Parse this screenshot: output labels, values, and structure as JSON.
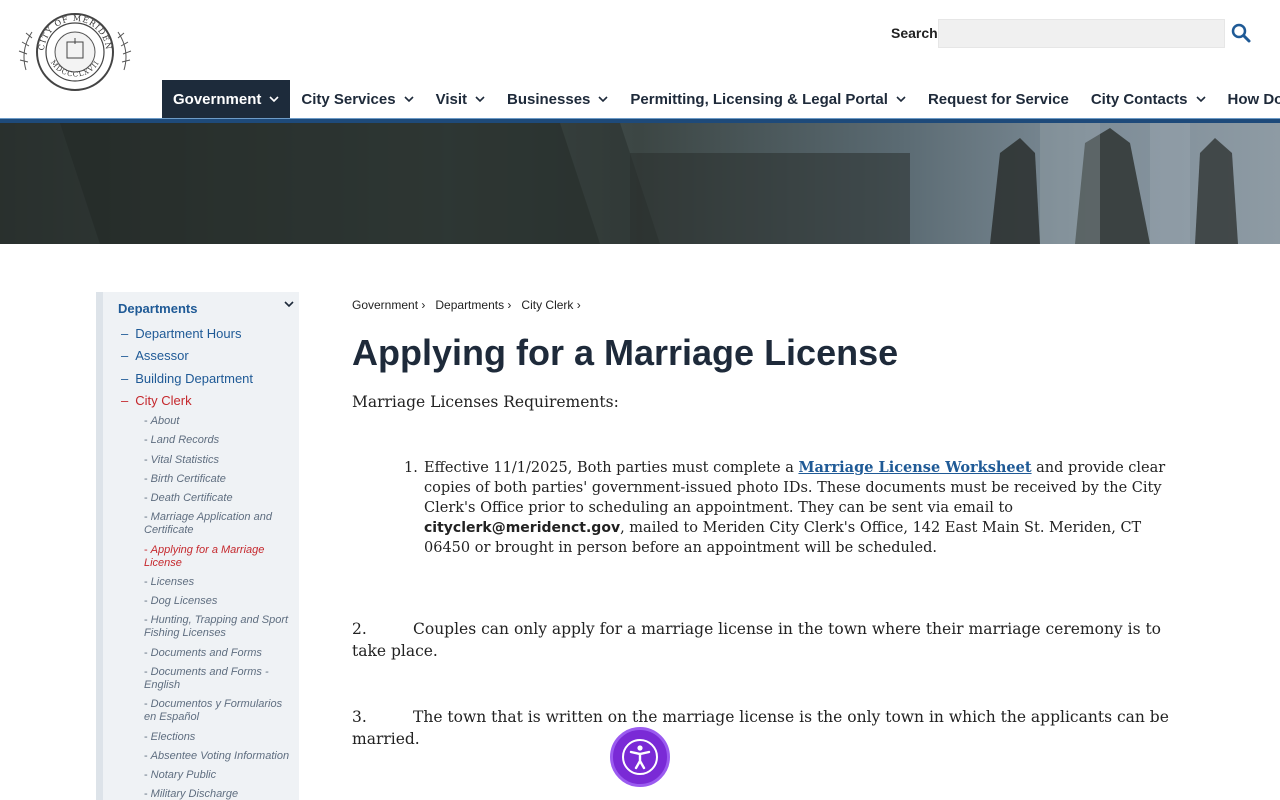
{
  "header": {
    "logo_alt": "City of Meriden seal",
    "logo_text_top": "CITY OF MERIDEN",
    "logo_text_bottom": "MDCCCLXVII",
    "search_label": "Search",
    "search_placeholder": ""
  },
  "nav": {
    "items": [
      {
        "label": "Government",
        "has_menu": true,
        "active": true
      },
      {
        "label": "City Services",
        "has_menu": true
      },
      {
        "label": "Visit",
        "has_menu": true
      },
      {
        "label": "Businesses",
        "has_menu": true
      },
      {
        "label": "Permitting, Licensing & Legal Portal",
        "has_menu": true
      },
      {
        "label": "Request for Service",
        "has_menu": false
      },
      {
        "label": "City Contacts",
        "has_menu": true
      },
      {
        "label": "How Do I?",
        "has_menu": true
      }
    ]
  },
  "colors": {
    "nav_active": "#1d2b3b",
    "nav_line": "#1e4a7a",
    "link": "#1f5a96",
    "active_red": "#c5282d",
    "a11y_purple": "#7a2ad6"
  },
  "sidebar": {
    "heading": "Departments",
    "level1": [
      {
        "label": "Department Hours"
      },
      {
        "label": "Assessor"
      },
      {
        "label": "Building Department"
      },
      {
        "label": "City Clerk",
        "active": true
      }
    ],
    "level2": [
      {
        "label": "About"
      },
      {
        "label": "Land Records"
      },
      {
        "label": "Vital Statistics"
      },
      {
        "label": "Birth Certificate"
      },
      {
        "label": "Death Certificate"
      },
      {
        "label": "Marriage Application and Certificate"
      },
      {
        "label": "Applying for a Marriage License",
        "active": true
      },
      {
        "label": "Licenses"
      },
      {
        "label": "Dog Licenses"
      },
      {
        "label": "Hunting, Trapping and Sport Fishing Licenses"
      },
      {
        "label": "Documents and Forms"
      },
      {
        "label": "Documents and Forms - English"
      },
      {
        "label": "Documentos y Formularios en Español"
      },
      {
        "label": "Elections"
      },
      {
        "label": "Absentee Voting Information"
      },
      {
        "label": "Notary Public"
      },
      {
        "label": "Military Discharge"
      }
    ]
  },
  "breadcrumb": [
    "Government",
    "Departments",
    "City Clerk"
  ],
  "main": {
    "title": "Applying for a Marriage License",
    "intro": "Marriage Licenses Requirements:",
    "item1": {
      "num": "1.",
      "text_a": "Effective 11/1/2025, Both parties must complete a ",
      "link": "Marriage License Worksheet",
      "text_b": " and provide clear copies of both parties' government-issued photo IDs.  These documents must be received by the City Clerk's Office prior to scheduling an appointment.  They can be sent via email to ",
      "email": "cityclerk@meridenct.gov",
      "text_c": ", mailed to Meriden City Clerk's Office, 142 East Main St. Meriden, CT 06450 or brought in person before an appointment will be scheduled."
    },
    "item2": {
      "num": "2.",
      "text": "Couples can only apply for a marriage license in the town where their marriage ceremony is to take place."
    },
    "item3": {
      "num": "3.",
      "text": "The town that is written on the marriage license is the only town in which the applicants can be married."
    }
  },
  "a11y": {
    "icon": "accessibility-icon"
  }
}
